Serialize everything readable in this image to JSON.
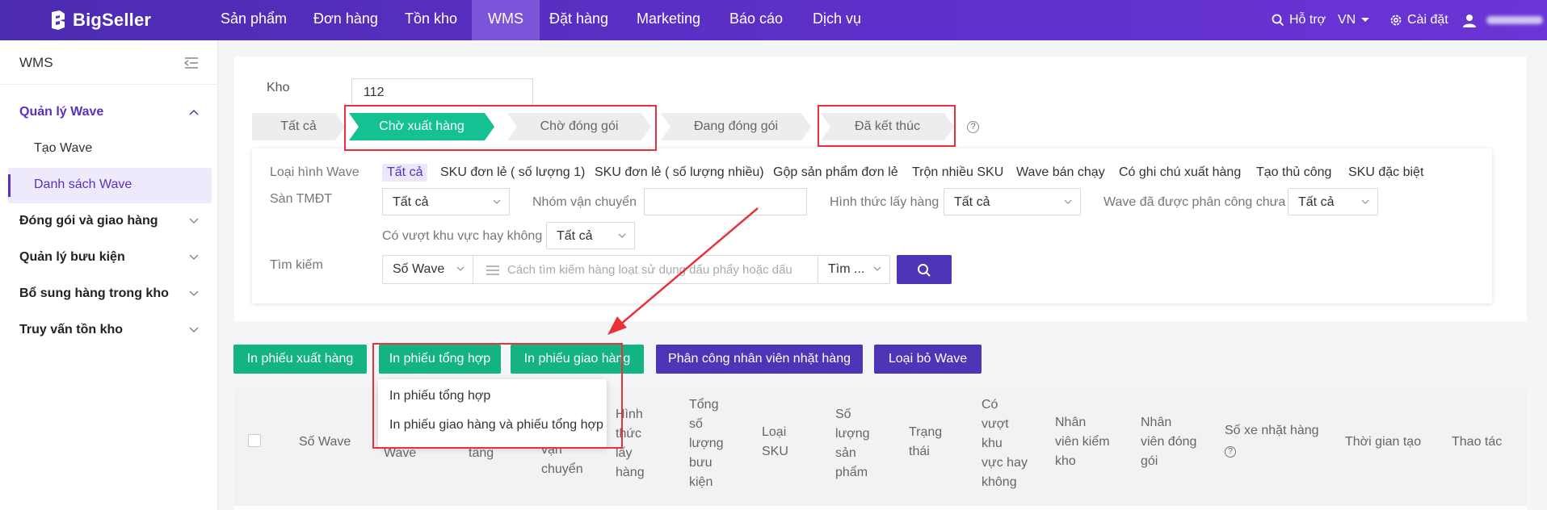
{
  "brand": {
    "name": "BigSeller"
  },
  "nav": {
    "items": [
      "Sản phẩm",
      "Đơn hàng",
      "Tồn kho",
      "WMS",
      "Đặt hàng",
      "Marketing",
      "Báo cáo",
      "Dịch vụ"
    ],
    "active": "WMS",
    "help": "Hỗ trợ",
    "lang": "VN",
    "settings": "Cài đặt"
  },
  "sidebar": {
    "title": "WMS",
    "groups": [
      {
        "label": "Quản lý Wave",
        "expanded": true
      },
      {
        "label": "Đóng gói và giao hàng"
      },
      {
        "label": "Quản lý bưu kiện"
      },
      {
        "label": "Bổ sung hàng trong kho"
      },
      {
        "label": "Truy vấn tồn kho"
      }
    ],
    "subitems": [
      "Tạo Wave",
      "Danh sách Wave"
    ],
    "active_subitem": "Danh sách Wave"
  },
  "filters": {
    "warehouse_label": "Kho",
    "warehouse_value": "112",
    "status_steps": [
      "Tất cả",
      "Chờ xuất hàng",
      "Chờ đóng gói",
      "Đang đóng gói",
      "Đã kết thúc"
    ],
    "active_step": "Chờ xuất hàng",
    "wave_type_label": "Loại hình Wave",
    "wave_types": [
      "Tất cả",
      "SKU đơn lẻ ( số lượng 1)",
      "SKU đơn lẻ ( số lượng nhiều)",
      "Gộp sản phẩm đơn lẻ",
      "Trộn nhiều SKU",
      "Wave bán chạy",
      "Có ghi chú xuất hàng",
      "Tạo thủ công",
      "SKU đặc biệt"
    ],
    "marketplace_label": "Sàn TMĐT",
    "marketplace_value": "Tất cả",
    "shipping_group_label": "Nhóm vận chuyển",
    "shipping_group_value": "",
    "pick_method_label": "Hình thức lấy hàng",
    "pick_method_value": "Tất cả",
    "assigned_label": "Wave đã được phân công chưa",
    "assigned_value": "Tất cả",
    "cross_zone_label": "Có vượt khu vực hay không",
    "cross_zone_value": "Tất cả",
    "search_label": "Tìm kiếm",
    "search_field": "Số Wave",
    "search_placeholder": "Cách tìm kiếm hàng loạt sử dụng dấu phẩy hoặc dấu",
    "search_mode": "Tìm ..."
  },
  "actions": {
    "print_picking": "In phiếu xuất hàng",
    "print_summary": "In phiếu tổng hợp",
    "print_delivery": "In phiếu giao hàng",
    "assign_picker": "Phân công nhân viên nhặt hàng",
    "remove_wave": "Loại bỏ Wave"
  },
  "dropdown": {
    "items": [
      "In phiếu tổng hợp",
      "In phiếu giao hàng và phiếu tổng hợp"
    ]
  },
  "table": {
    "columns": [
      [
        "Số Wave"
      ],
      [
        "Wave"
      ],
      [
        "tầng"
      ],
      [
        "vận",
        "chuyển"
      ],
      [
        "Hình",
        "thức",
        "lấy",
        "hàng"
      ],
      [
        "Tổng",
        "số",
        "lượng",
        "bưu",
        "kiện"
      ],
      [
        "Loại",
        "SKU"
      ],
      [
        "Số",
        "lượng",
        "sản",
        "phẩm"
      ],
      [
        "Trạng",
        "thái"
      ],
      [
        "Có",
        "vượt",
        "khu",
        "vực hay",
        "không"
      ],
      [
        "Nhân",
        "viên kiểm",
        "kho"
      ],
      [
        "Nhân",
        "viên đóng",
        "gói"
      ],
      [
        "Số xe nhặt hàng"
      ],
      [
        "Thời gian tạo"
      ],
      [
        "Thao tác"
      ]
    ]
  },
  "colors": {
    "nav_bg": "#5a2fc4",
    "accent_purple": "#4e35b8",
    "accent_green": "#14b383",
    "annotation_red": "#e8313a"
  }
}
